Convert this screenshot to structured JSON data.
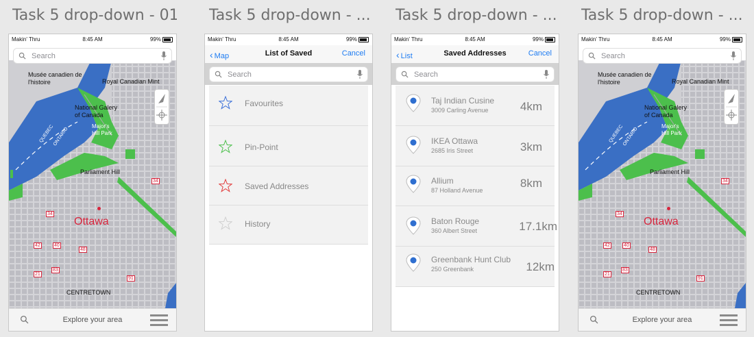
{
  "artboards": [
    {
      "title": "Task 5 drop-down - 01"
    },
    {
      "title": "Task 5 drop-down - ..."
    },
    {
      "title": "Task 5 drop-down - ..."
    },
    {
      "title": "Task 5 drop-down - ..."
    }
  ],
  "status_bar": {
    "carrier": "Makin' Thru",
    "time": "8:45 AM",
    "battery": "99%"
  },
  "map_screen": {
    "search_placeholder": "Search",
    "labels": {
      "museum": "Musée canadien de l'histoire",
      "mint": "Royal Canadian Mint",
      "gallery": "National Galery of Canada",
      "hill_park": "Major's Hill Park",
      "quebec": "QUEBEC",
      "ontario": "ONTARIO",
      "parliament": "Parliament Hill",
      "city": "Ottawa",
      "centretown": "CENTRETOWN"
    },
    "road_shields": [
      "34",
      "34",
      "42",
      "40",
      "48",
      "21",
      "83",
      "91"
    ],
    "bottom": {
      "explore": "Explore your area"
    }
  },
  "saved_list_screen": {
    "back_label": "Map",
    "title": "List of Saved",
    "cancel_label": "Cancel",
    "search_placeholder": "Search",
    "items": [
      {
        "label": "Favourites",
        "star_color": "#3a6fd8"
      },
      {
        "label": "Pin-Point",
        "star_color": "#4cbf4c"
      },
      {
        "label": "Saved Addresses",
        "star_color": "#e23b3b"
      },
      {
        "label": "History",
        "star_color": "#d0d0d0"
      }
    ]
  },
  "saved_addresses_screen": {
    "back_label": "List",
    "title": "Saved Addresses",
    "cancel_label": "Cancel",
    "search_placeholder": "Search",
    "addresses": [
      {
        "name": "Taj Indian Cusine",
        "street": "3009 Carling Avenue",
        "distance": "4km"
      },
      {
        "name": "IKEA Ottawa",
        "street": "2685 Iris Street",
        "distance": "3km"
      },
      {
        "name": "Allium",
        "street": "87 Holland Avenue",
        "distance": "8km"
      },
      {
        "name": "Baton Rouge",
        "street": "360 Albert Street",
        "distance": "17.1km"
      },
      {
        "name": "Greenbank Hunt Club",
        "street": "250 Greenbank",
        "distance": "12km"
      }
    ]
  },
  "colors": {
    "accent_blue": "#1e7cf2",
    "water": "#3a6fc4",
    "park": "#4cbf4c",
    "city_label": "#d8243c",
    "pin_dot": "#2f6fd0"
  }
}
